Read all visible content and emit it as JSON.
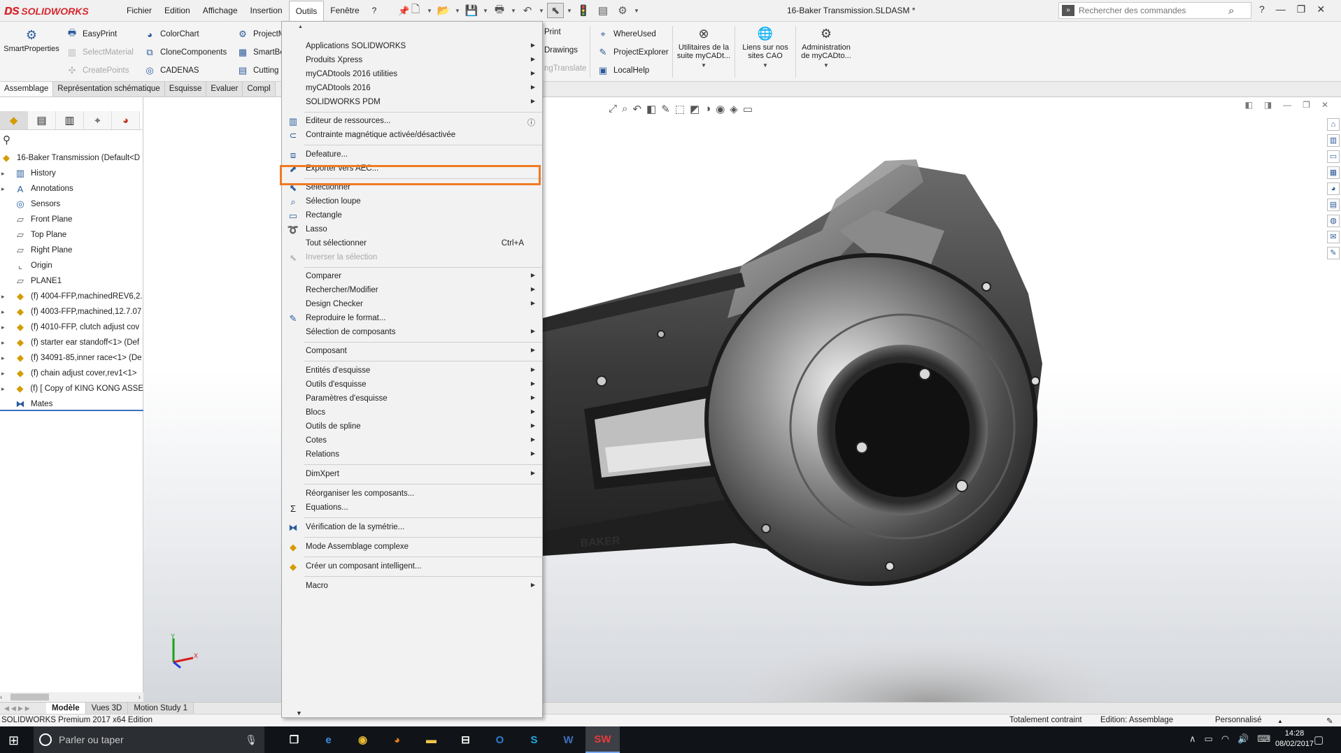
{
  "app": {
    "brand": "SOLIDWORKS",
    "doc_title": "16-Baker Transmission.SLDASM *"
  },
  "menubar": [
    "Fichier",
    "Edition",
    "Affichage",
    "Insertion",
    "Outils",
    "Fenêtre",
    "?"
  ],
  "menubar_active": "Outils",
  "command_search": {
    "placeholder": "Rechercher des commandes"
  },
  "ribbon": {
    "smartproperties": "SmartProperties",
    "col1": [
      "EasyPrint",
      "SelectMaterial",
      "CreatePoints"
    ],
    "col2": [
      "ColorChart",
      "CloneComponents",
      "CADENAS"
    ],
    "col3": [
      "ProjectM",
      "SmartBo",
      "Cutting"
    ],
    "col4": [
      "Print",
      "Drawings",
      "ngTranslate"
    ],
    "col5": [
      "WhereUsed",
      "ProjectExplorer",
      "LocalHelp"
    ],
    "big1": "Utilitaires de la suite myCADt...",
    "big2": "Liens sur nos sites CAO",
    "big3": "Administration de myCADto..."
  },
  "tabs": [
    "Assemblage",
    "Représentation schématique",
    "Esquisse",
    "Evaluer",
    "Compl"
  ],
  "tabs_active": "Assemblage",
  "tree": {
    "root": "16-Baker Transmission  (Default<D",
    "nodes": [
      {
        "label": "History",
        "icon": "folder-icon",
        "expandable": true
      },
      {
        "label": "Annotations",
        "icon": "annotations-icon",
        "expandable": true
      },
      {
        "label": "Sensors",
        "icon": "sensors-icon",
        "expandable": false
      },
      {
        "label": "Front Plane",
        "icon": "plane-icon",
        "expandable": false
      },
      {
        "label": "Top Plane",
        "icon": "plane-icon",
        "expandable": false
      },
      {
        "label": "Right Plane",
        "icon": "plane-icon",
        "expandable": false
      },
      {
        "label": "Origin",
        "icon": "origin-icon",
        "expandable": false
      },
      {
        "label": "PLANE1",
        "icon": "plane-icon",
        "expandable": false
      },
      {
        "label": "(f) 4004-FFP,machinedREV6,2.",
        "icon": "part-icon",
        "expandable": true
      },
      {
        "label": "(f) 4003-FFP,machined,12.7.07",
        "icon": "part-icon",
        "expandable": true
      },
      {
        "label": "(f) 4010-FFP, clutch adjust cov",
        "icon": "part-icon",
        "expandable": true
      },
      {
        "label": "(f) starter ear standoff<1> (Def",
        "icon": "part-icon",
        "expandable": true
      },
      {
        "label": "(f) 34091-85,inner race<1> (De",
        "icon": "part-icon",
        "expandable": true
      },
      {
        "label": "(f) chain adjust cover,rev1<1>",
        "icon": "part-icon",
        "expandable": true
      },
      {
        "label": "(f) [ Copy of KING KONG ASSE",
        "icon": "subassembly-icon",
        "expandable": true
      },
      {
        "label": "Mates",
        "icon": "mates-icon",
        "expandable": false
      }
    ]
  },
  "menu_outils": {
    "items": [
      {
        "label": "Applications SOLIDWORKS",
        "submenu": true,
        "icon": ""
      },
      {
        "label": "Produits Xpress",
        "submenu": true,
        "icon": ""
      },
      {
        "label": "myCADtools 2016 utilities",
        "submenu": true,
        "icon": ""
      },
      {
        "label": "myCADtools 2016",
        "submenu": true,
        "icon": ""
      },
      {
        "label": "SOLIDWORKS PDM",
        "submenu": true,
        "icon": ""
      },
      {
        "label": "Editeur de ressources...",
        "submenu": false,
        "icon": "resource-editor-icon",
        "trailing_icon": "help-icon"
      },
      {
        "label": "Contrainte magnétique activée/désactivée",
        "submenu": false,
        "icon": "magnetic-mate-icon"
      },
      {
        "label": "Defeature...",
        "submenu": false,
        "icon": "defeature-icon"
      },
      {
        "label": "Exporter vers AEC...",
        "submenu": false,
        "icon": "export-aec-icon"
      },
      {
        "label": "Sélectionner",
        "submenu": false,
        "icon": "select-arrow-icon"
      },
      {
        "label": "Sélection loupe",
        "submenu": false,
        "icon": "magnifier-select-icon"
      },
      {
        "label": "Rectangle",
        "submenu": false,
        "icon": "box-select-icon"
      },
      {
        "label": "Lasso",
        "submenu": false,
        "icon": "lasso-icon"
      },
      {
        "label": "Tout sélectionner",
        "submenu": false,
        "icon": "",
        "shortcut": "Ctrl+A"
      },
      {
        "label": "Inverser la sélection",
        "submenu": false,
        "icon": "invert-selection-icon",
        "disabled": true
      },
      {
        "label": "Comparer",
        "submenu": true,
        "icon": ""
      },
      {
        "label": "Rechercher/Modifier",
        "submenu": true,
        "icon": ""
      },
      {
        "label": "Design Checker",
        "submenu": true,
        "icon": ""
      },
      {
        "label": "Reproduire le format...",
        "submenu": false,
        "icon": "format-painter-icon"
      },
      {
        "label": "Sélection de composants",
        "submenu": true,
        "icon": ""
      },
      {
        "label": "Composant",
        "submenu": true,
        "icon": ""
      },
      {
        "label": "Entités d'esquisse",
        "submenu": true,
        "icon": ""
      },
      {
        "label": "Outils d'esquisse",
        "submenu": true,
        "icon": ""
      },
      {
        "label": "Paramètres d'esquisse",
        "submenu": true,
        "icon": ""
      },
      {
        "label": "Blocs",
        "submenu": true,
        "icon": ""
      },
      {
        "label": "Outils de spline",
        "submenu": true,
        "icon": ""
      },
      {
        "label": "Cotes",
        "submenu": true,
        "icon": ""
      },
      {
        "label": "Relations",
        "submenu": true,
        "icon": ""
      },
      {
        "label": "DimXpert",
        "submenu": true,
        "icon": ""
      },
      {
        "label": "Réorganiser les composants...",
        "submenu": false,
        "icon": ""
      },
      {
        "label": "Equations...",
        "submenu": false,
        "icon": "sigma-icon"
      },
      {
        "label": "Vérification de la symétrie...",
        "submenu": false,
        "icon": "symmetry-check-icon"
      },
      {
        "label": "Mode Assemblage complexe",
        "submenu": false,
        "icon": "large-assembly-icon"
      },
      {
        "label": "Créer un composant intelligent...",
        "submenu": false,
        "icon": "smart-component-icon"
      },
      {
        "label": "Macro",
        "submenu": true,
        "icon": ""
      }
    ],
    "highlighted": "Defeature..."
  },
  "bottom_tabs": [
    "Modèle",
    "Vues 3D",
    "Motion Study 1"
  ],
  "bottom_tabs_active": "Modèle",
  "status": {
    "edition": "SOLIDWORKS Premium 2017 x64 Edition",
    "constraint": "Totalement contraint",
    "mode": "Edition: Assemblage",
    "units": "Personnalisé"
  },
  "taskbar": {
    "search_placeholder": "Parler ou taper",
    "time": "14:28",
    "date": "08/02/2017"
  },
  "colors": {
    "brand_red": "#d8262e",
    "highlight_orange": "#f07a23",
    "tree_selection_line": "#3a72c0",
    "taskbar": "#101418"
  }
}
